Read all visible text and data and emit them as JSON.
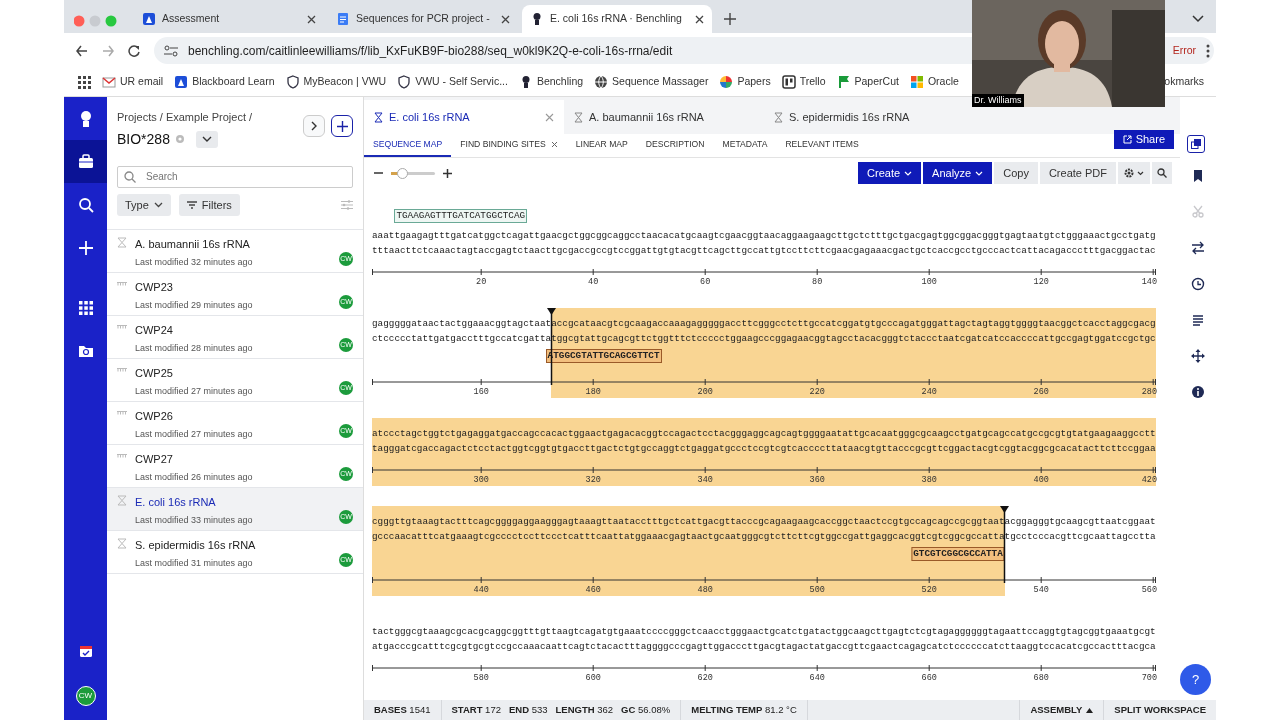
{
  "browser": {
    "tabs": [
      {
        "title": "Assessment",
        "kind": "app",
        "selected": false
      },
      {
        "title": "Sequences for PCR project -",
        "kind": "document",
        "selected": false
      },
      {
        "title": "E. coli 16s rRNA · Benchling",
        "kind": "figure",
        "selected": true
      }
    ],
    "url": "benchling.com/caitlinleewilliams/f/lib_KxFuKB9F-bio288/seq_w0kl9K2Q-e-coli-16s-rrna/edit",
    "address_status": "Error",
    "bookmarks": [
      {
        "label": "UR email",
        "kind": "mail"
      },
      {
        "label": "Blackboard Learn",
        "kind": "app"
      },
      {
        "label": "MyBeacon | VWU",
        "kind": "shield"
      },
      {
        "label": "VWU - Self Servic...",
        "kind": "shield"
      },
      {
        "label": "Benchling",
        "kind": "figure"
      },
      {
        "label": "Sequence Massager",
        "kind": "globe"
      },
      {
        "label": "Papers",
        "kind": "pinwheel"
      },
      {
        "label": "Trello",
        "kind": "board"
      },
      {
        "label": "PaperCut",
        "kind": "flag"
      },
      {
        "label": "Oracle",
        "kind": "squares"
      },
      {
        "label": "okmarks",
        "kind": "none"
      }
    ]
  },
  "video_overlay": {
    "caption": "Dr. Williams"
  },
  "help": "?",
  "rail": {
    "items": [
      {
        "kind": "figure",
        "selected": false
      },
      {
        "kind": "briefcase",
        "selected": true
      },
      {
        "kind": "search",
        "selected": false
      },
      {
        "kind": "plus",
        "selected": false
      },
      {
        "kind": "grid",
        "selected": false
      },
      {
        "kind": "folder",
        "selected": false
      }
    ],
    "avatar": "CW"
  },
  "sidebar": {
    "breadcrumb": "Projects / Example Project /",
    "project": "BIO*288",
    "search_placeholder": "Search",
    "filters": [
      {
        "label": "Type",
        "kind": "dropdown"
      },
      {
        "label": "Filters",
        "kind": "filter"
      }
    ],
    "items": [
      {
        "name": "A. baumannii 16s rRNA",
        "modified": "Last modified 32 minutes ago",
        "kind": "dna",
        "owner": "CW",
        "selected": false
      },
      {
        "name": "CWP23",
        "modified": "Last modified 29 minutes ago",
        "kind": "oligo",
        "owner": "CW",
        "selected": false
      },
      {
        "name": "CWP24",
        "modified": "Last modified 28 minutes ago",
        "kind": "oligo",
        "owner": "CW",
        "selected": false
      },
      {
        "name": "CWP25",
        "modified": "Last modified 27 minutes ago",
        "kind": "oligo",
        "owner": "CW",
        "selected": false
      },
      {
        "name": "CWP26",
        "modified": "Last modified 27 minutes ago",
        "kind": "oligo",
        "owner": "CW",
        "selected": false
      },
      {
        "name": "CWP27",
        "modified": "Last modified 26 minutes ago",
        "kind": "oligo",
        "owner": "CW",
        "selected": false
      },
      {
        "name": "E. coli 16s rRNA",
        "modified": "Last modified 33 minutes ago",
        "kind": "dna",
        "owner": "CW",
        "selected": true
      },
      {
        "name": "S. epidermidis 16s rRNA",
        "modified": "Last modified 31 minutes ago",
        "kind": "dna",
        "owner": "CW",
        "selected": false
      }
    ]
  },
  "doc_tabs": [
    {
      "title": "E. coli 16s rRNA",
      "selected": true
    },
    {
      "title": "A. baumannii 16s rRNA",
      "selected": false
    },
    {
      "title": "S. epidermidis 16s rRNA",
      "selected": false
    }
  ],
  "view_tabs": [
    {
      "label": "SEQUENCE MAP",
      "selected": true,
      "closable": false
    },
    {
      "label": "FIND BINDING SITES",
      "selected": false,
      "closable": true
    },
    {
      "label": "LINEAR MAP",
      "selected": false,
      "closable": false
    },
    {
      "label": "DESCRIPTION",
      "selected": false,
      "closable": false
    },
    {
      "label": "METADATA",
      "selected": false,
      "closable": false
    },
    {
      "label": "RELEVANT ITEMS",
      "selected": false,
      "closable": false
    }
  ],
  "share": "Share",
  "toolbar": {
    "zoom": {
      "level": 0.25
    },
    "buttons": [
      {
        "label": "Create",
        "kind": "primary"
      },
      {
        "label": "Analyze",
        "kind": "primary"
      },
      {
        "label": "Copy",
        "kind": "secondary"
      },
      {
        "label": "Create PDF",
        "kind": "secondary"
      }
    ]
  },
  "sequence_rows": [
    {
      "top": [
        {
          "text": "aaat",
          "selected": false
        },
        {
          "text": "tgaagagtttgatcatggctcag",
          "selected": false,
          "primer": {
            "text": "TGAAGAGTTTGATCATGGCTCAG",
            "kind": "forward"
          }
        },
        {
          "text": "attgaacgctggcggcaggcctaacacatgcaagtcgaacggtaacaggaagaagcttgctctttgctgacgagtggcggacgggtgagtaatgtctgggaaactgcctgatg",
          "selected": false
        }
      ],
      "bottom": [
        {
          "text": "tttaacttctcaaactagtaccgagtctaacttgcgaccgccgtccggattgtgtacgttcagcttgccattgtccttcttcgaacgagaaacgactgctcaccgcctgcccactcattacagaccctttgacggactac",
          "selected": false
        }
      ],
      "ruler": [
        "20",
        "40",
        "60",
        "80",
        "100",
        "120",
        "140"
      ]
    },
    {
      "top": [
        {
          "text": "gagggggataactactggaaacggtagctaat",
          "selected": false
        },
        {
          "text": "accgcataacgtcgcaagaccaaagagggggaccttcgggcctcttgccatcggatgtgcccagatgggattagctagtaggtggggtaacggctcacctaggcgacg",
          "selected": true
        }
      ],
      "bottom": [
        {
          "text": "ctccccctattgatgacctttgccatcgatt",
          "selected": false
        },
        {
          "text": "a",
          "selected": false,
          "primer": {
            "text": "ATGGCGTATTGCAGCGTTCT",
            "kind": "reverse"
          }
        },
        {
          "text": "tggcgtattgcagcgttctggtttctccccctggaagcccggagaacggtagcctacacgggtctaccctaatcgatcatccaccccattgccgagtggatccgctgc",
          "selected": true
        }
      ],
      "ruler": [
        "160",
        "180",
        "200",
        "220",
        "240",
        "260",
        "280"
      ]
    },
    {
      "top": [
        {
          "text": "atccctagctggtctgagaggatgaccagccacactggaactgagacacggtccagactcctacgggaggcagcagtggggaatattgcacaatgggcgcaagcctgatgcagccatgccgcgtgtatgaagaaggcctt",
          "selected": true
        }
      ],
      "bottom": [
        {
          "text": "tagggatcgaccagactctcctactggtcggtgtgaccttgactctgtgccaggtctgaggatgccctccgtcgtcaccccttataacgtgttacccgcgttcggactacgtcggtacggcgcacatacttcttccggaa",
          "selected": true
        }
      ],
      "ruler": [
        "300",
        "320",
        "340",
        "360",
        "380",
        "400",
        "420"
      ]
    },
    {
      "top": [
        {
          "text": "cgggttgtaaagtactttcagcggggaggaagggagtaaagttaatacctttgctcattgacgttacccgcagaagaagcaccggctaactccgtgccagcagccgcggtaat",
          "selected": true
        },
        {
          "text": "acggagggtgcaagcgttaatcggaat",
          "selected": false
        }
      ],
      "bottom": [
        {
          "text": "gcccaacatttcatgaaagtcgcccctccttccctcatttcaattatggaaacgagtaactgcaatgggcgtcttcttcgtggccgattgaggcacg",
          "selected": true
        },
        {
          "text": "gtcgtcggcgccatta",
          "selected": true,
          "primer": {
            "text": "GTCGTCGGCGCCATTA",
            "kind": "reverse"
          }
        },
        {
          "text": "tgcctcccacgttcgcaattagcctta",
          "selected": false
        }
      ],
      "ruler": [
        "440",
        "460",
        "480",
        "500",
        "520",
        "540",
        "560"
      ]
    },
    {
      "top": [
        {
          "text": "tactgggcgtaaagcgcacgcaggcggtttgttaagtcagatgtgaaatccccgggctcaacctgggaactgcatctgatactggcaagcttgagtctcgtagaggggggtagaattccaggtgtagcggtgaaatgcgt",
          "selected": false
        }
      ],
      "bottom": [
        {
          "text": "atgacccgcatttcgcgtgcgtccgccaaacaattcagtctacactttaggggcccgagttggacccttgacgtagactatgaccgttcgaactcagagcatctccccccatcttaaggtccacatcgccactttacgca",
          "selected": false
        }
      ],
      "ruler": [
        "580",
        "600",
        "620",
        "640",
        "660",
        "680",
        "700"
      ]
    }
  ],
  "right_rail": [
    {
      "kind": "bookmark",
      "disabled": false
    },
    {
      "kind": "scissors",
      "disabled": true
    },
    {
      "kind": "swap",
      "disabled": false
    },
    {
      "kind": "clock",
      "disabled": false
    },
    {
      "kind": "list",
      "disabled": false
    },
    {
      "kind": "move",
      "disabled": false
    },
    {
      "kind": "info",
      "disabled": false
    }
  ],
  "status_bar": {
    "groups": [
      [
        {
          "label": "BASES",
          "value": "1541"
        }
      ],
      [
        {
          "label": "START",
          "value": "172"
        },
        {
          "label": "END",
          "value": "533"
        },
        {
          "label": "LENGTH",
          "value": "362"
        },
        {
          "label": "GC",
          "value": "56.08%"
        }
      ],
      [
        {
          "label": "MELTING TEMP",
          "value": "81.2 °C"
        }
      ]
    ],
    "menus": [
      {
        "label": "ASSEMBLY",
        "caret": true
      },
      {
        "label": "SPLIT WORKSPACE",
        "caret": false
      }
    ]
  }
}
